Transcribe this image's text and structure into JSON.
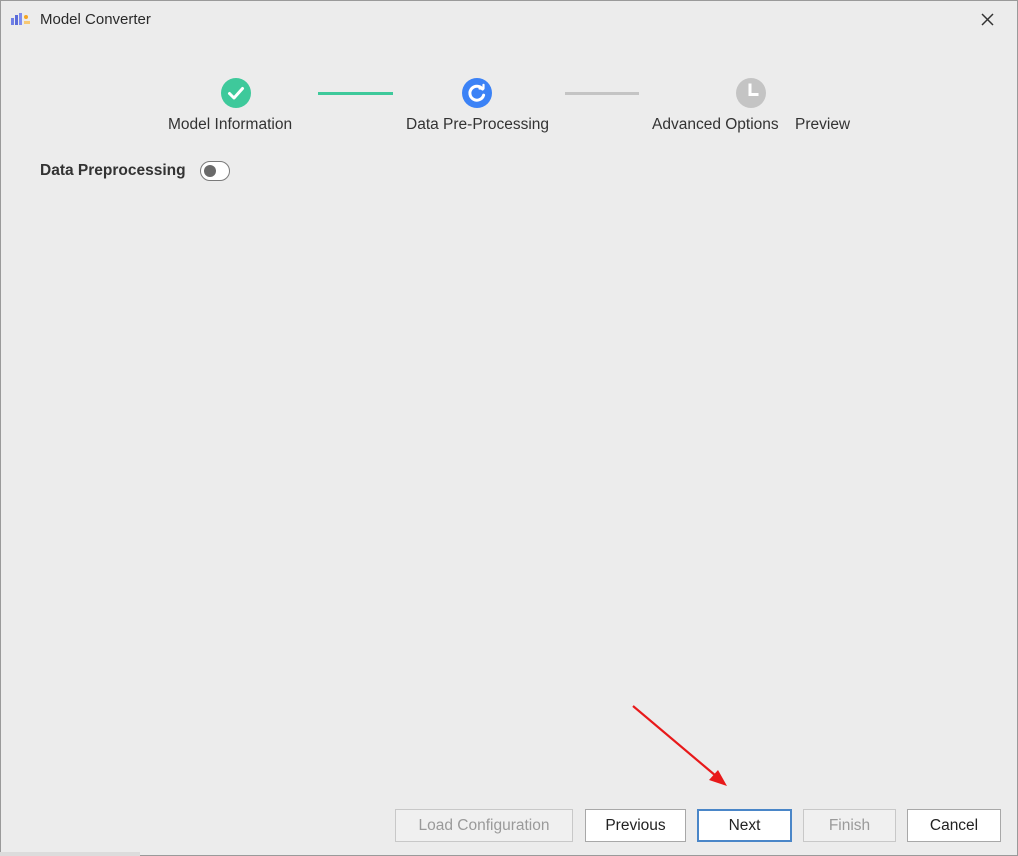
{
  "window": {
    "title": "Model Converter",
    "app_icon": "app-logo-icon",
    "close_icon": "close-icon"
  },
  "stepper": {
    "steps": [
      {
        "label": "Model Information",
        "status": "completed",
        "icon": "check-circle-icon",
        "color": "#3ec99b"
      },
      {
        "label": "Data Pre-Processing",
        "status": "in-progress",
        "icon": "refresh-circle-icon",
        "color": "#3b82f6"
      },
      {
        "label": "Advanced Options",
        "status": "pending",
        "icon": "clock-circle-icon",
        "color": "#c4c4c4"
      },
      {
        "label": "Preview",
        "status": "pending"
      }
    ],
    "connector_done_color": "#3ec99b",
    "connector_pending_color": "#c4c4c4"
  },
  "data_preprocessing": {
    "label": "Data Preprocessing",
    "enabled": false
  },
  "footer": {
    "load_configuration": "Load Configuration",
    "previous": "Previous",
    "next": "Next",
    "finish": "Finish",
    "cancel": "Cancel"
  },
  "annotation": {
    "arrow_color": "#e8191a",
    "points_to": "Next"
  }
}
